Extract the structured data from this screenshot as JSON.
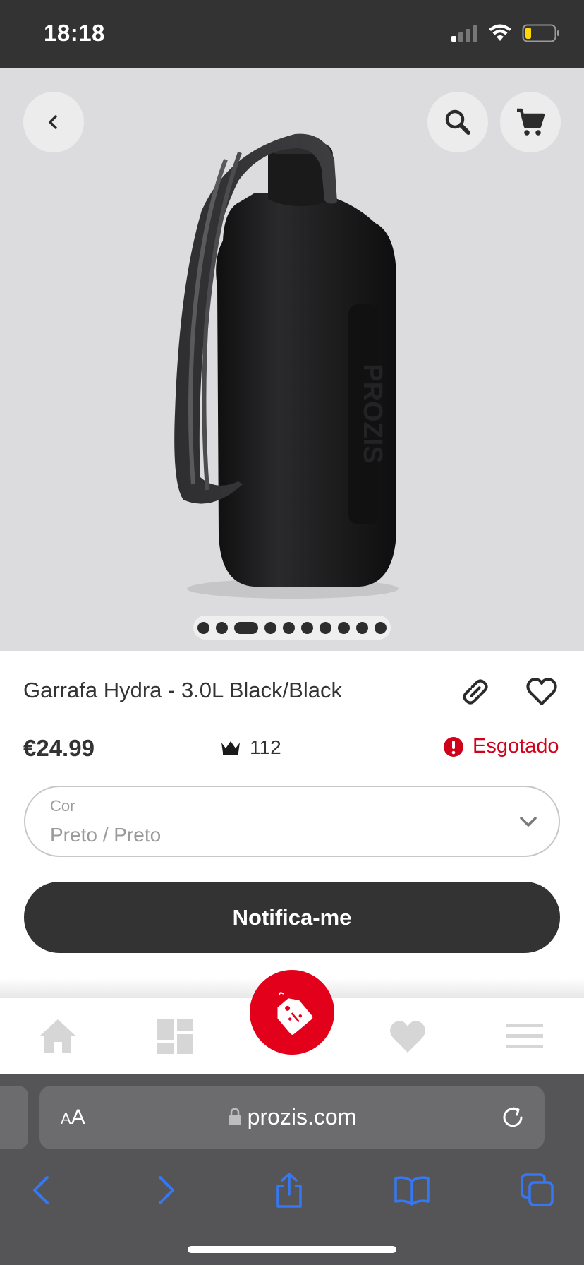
{
  "status_bar": {
    "time": "18:18"
  },
  "product": {
    "title": "Garrafa Hydra - 3.0L Black/Black",
    "price": "€24.99",
    "points": "112",
    "stock_status": "Esgotado",
    "image_dots": 10,
    "active_dot": 2
  },
  "option": {
    "label": "Cor",
    "value": "Preto / Preto"
  },
  "actions": {
    "notify_label": "Notifica-me"
  },
  "browser": {
    "text_size_label_small": "A",
    "text_size_label_large": "A",
    "domain": "prozis.com"
  },
  "colors": {
    "accent": "#e2001a",
    "dark": "#333333",
    "out_of_stock": "#d0021b",
    "safari_blue": "#3478f6"
  }
}
